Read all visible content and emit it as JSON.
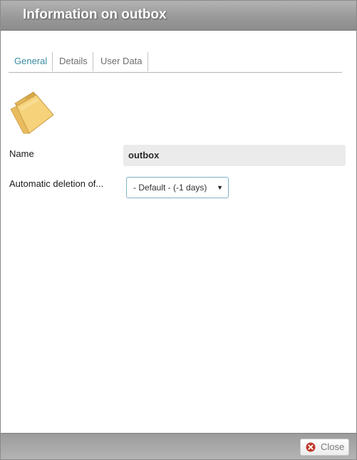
{
  "dialog": {
    "title": "Information on outbox"
  },
  "tabs": [
    {
      "label": "General",
      "active": true
    },
    {
      "label": "Details",
      "active": false
    },
    {
      "label": "User Data",
      "active": false
    }
  ],
  "icon": "folder-icon",
  "form": {
    "name_label": "Name",
    "name_value": "outbox",
    "deletion_label": "Automatic deletion of...",
    "deletion_selected": "- Default - (-1 days)"
  },
  "footer": {
    "close_label": "Close",
    "close_icon": "close-icon"
  },
  "colors": {
    "accent": "#3a8ca4",
    "titlebar": "#9a9a9a",
    "folder": "#f2cf73",
    "close_icon": "#c0392b"
  }
}
